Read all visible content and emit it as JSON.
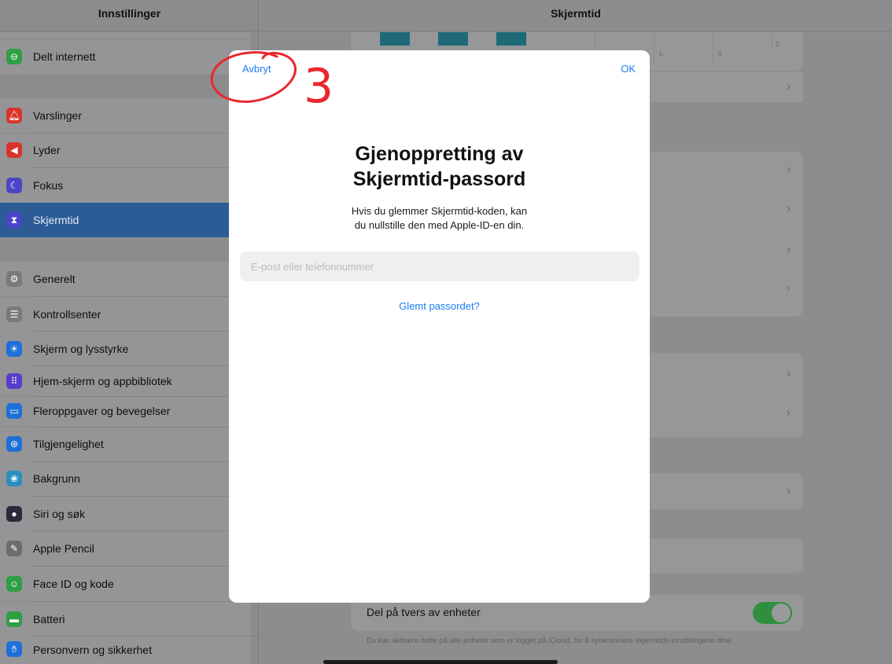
{
  "sidebar": {
    "title": "Innstillinger",
    "items": [
      {
        "label": "Delt internett",
        "icon": "link-icon",
        "color": "#2f9e44"
      },
      {
        "label": "Varslinger",
        "icon": "bell-icon",
        "color": "#d9342b"
      },
      {
        "label": "Lyder",
        "icon": "speaker-icon",
        "color": "#d9342b"
      },
      {
        "label": "Fokus",
        "icon": "moon-icon",
        "color": "#4b45c6"
      },
      {
        "label": "Skjermtid",
        "icon": "hourglass-icon",
        "color": "#4b45c6",
        "selected": true
      },
      {
        "label": "Generelt",
        "icon": "gear-icon",
        "color": "#7a7a7c"
      },
      {
        "label": "Kontrollsenter",
        "icon": "toggles-icon",
        "color": "#7a7a7c"
      },
      {
        "label": "Skjerm og lysstyrke",
        "icon": "sun-icon",
        "color": "#1f6fd8"
      },
      {
        "label": "Hjem-skjerm og appbibliotek",
        "icon": "app-grid-icon",
        "color": "#5a3ec8"
      },
      {
        "label": "Fleroppgaver og bevegelser",
        "icon": "multitask-icon",
        "color": "#1f6fd8"
      },
      {
        "label": "Tilgjengelighet",
        "icon": "accessibility-icon",
        "color": "#1f6fd8"
      },
      {
        "label": "Bakgrunn",
        "icon": "flower-icon",
        "color": "#2a8fbf"
      },
      {
        "label": "Siri og søk",
        "icon": "siri-icon",
        "color": "#2a2a3a"
      },
      {
        "label": "Apple Pencil",
        "icon": "pencil-icon",
        "color": "#6d6d6f"
      },
      {
        "label": "Face ID og kode",
        "icon": "face-id-icon",
        "color": "#2f9e44"
      },
      {
        "label": "Batteri",
        "icon": "battery-icon",
        "color": "#2f9e44"
      },
      {
        "label": "Personvern og sikkerhet",
        "icon": "hand-icon",
        "color": "#1f6fd8"
      }
    ]
  },
  "main": {
    "title": "Skjermtid",
    "chart_axis": {
      "zero": "0",
      "day1": "L",
      "day2": "S"
    }
  },
  "modal": {
    "cancel_label": "Avbryt",
    "ok_label": "OK",
    "title_line1": "Gjenoppretting av",
    "title_line2": "Skjermtid-passord",
    "desc_line1": "Hvis du glemmer Skjermtid-koden, kan",
    "desc_line2": "du nullstille den med Apple-ID-en din.",
    "field_placeholder": "E-post eller telefonnummer",
    "forgot_label": "Glemt passordet?"
  },
  "share": {
    "label": "Del på tvers av enheter",
    "enabled": true,
    "footnote": "Du kan aktivere dette på alle enheter som er logget på iCloud, for å synkronisere skjermtids-innstillingene dine."
  },
  "annotation": {
    "number": "3",
    "color": "#e8282d"
  }
}
